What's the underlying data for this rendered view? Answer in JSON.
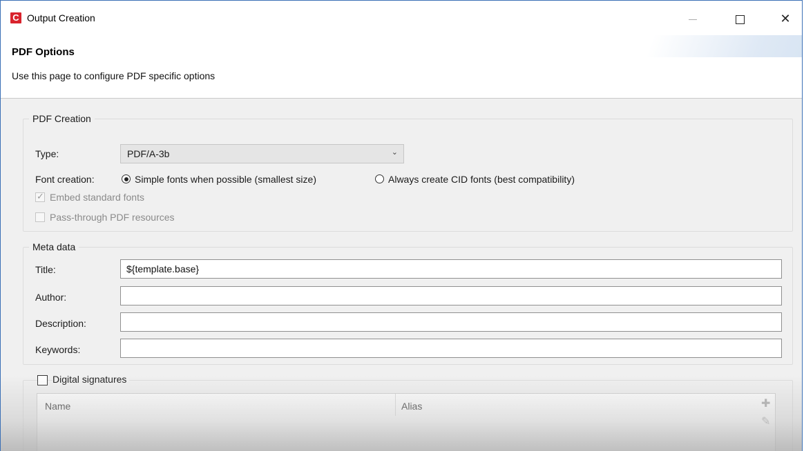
{
  "window": {
    "title": "Output Creation",
    "app_icon_letter": "C",
    "accent_color": "#d9232d"
  },
  "header": {
    "title": "PDF Options",
    "subtitle": "Use this page to configure PDF specific options"
  },
  "pdf_creation": {
    "legend": "PDF Creation",
    "type_label": "Type:",
    "type_value": "PDF/A-3b",
    "font_creation_label": "Font creation:",
    "font_option_simple": "Simple fonts when possible (smallest size)",
    "font_option_cid": "Always create CID fonts (best compatibility)",
    "selected_font_option": "simple",
    "embed_standard_fonts": "Embed standard fonts",
    "embed_standard_fonts_checked": true,
    "passthrough_resources": "Pass-through PDF resources",
    "passthrough_resources_checked": false
  },
  "meta_data": {
    "legend": "Meta data",
    "title_label": "Title:",
    "title_value": "${template.base}",
    "author_label": "Author:",
    "author_value": "",
    "description_label": "Description:",
    "description_value": "",
    "keywords_label": "Keywords:",
    "keywords_value": ""
  },
  "digital_signatures": {
    "label": "Digital signatures",
    "checked": false,
    "columns": [
      "Name",
      "Alias"
    ],
    "add_icon": "add-icon",
    "edit_icon": "edit-icon"
  }
}
